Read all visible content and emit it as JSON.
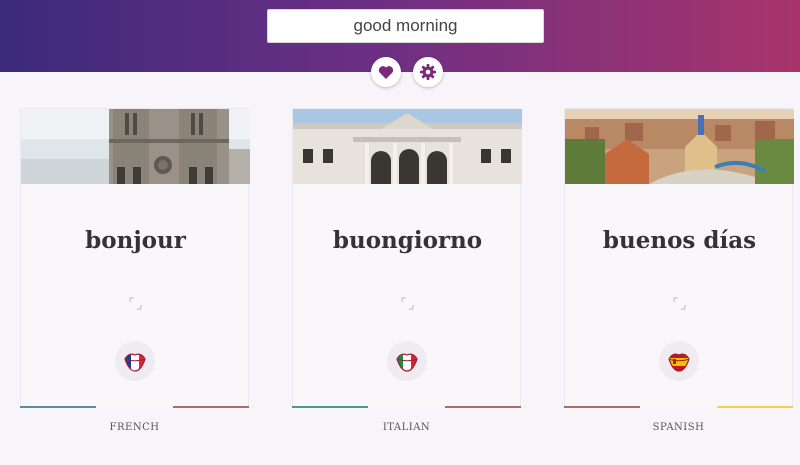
{
  "search": {
    "value": "good morning"
  },
  "toolbar": {
    "favorite_icon": "heart-icon",
    "settings_icon": "gear-icon"
  },
  "colors": {
    "accent": "#7b2a7a"
  },
  "cards": [
    {
      "word": "bonjour",
      "language": "FRENCH",
      "flag_colors": [
        "#1b3c99",
        "#ffffff",
        "#d8283a"
      ],
      "photo": "notre-dame"
    },
    {
      "word": "buongiorno",
      "language": "ITALIAN",
      "flag_colors": [
        "#129447",
        "#ffffff",
        "#cf2a37"
      ],
      "photo": "church-facade"
    },
    {
      "word": "buenos días",
      "language": "SPANISH",
      "flag_colors": [
        "#c4161c",
        "#f2c200",
        "#c4161c"
      ],
      "photo": "park-guell"
    }
  ]
}
